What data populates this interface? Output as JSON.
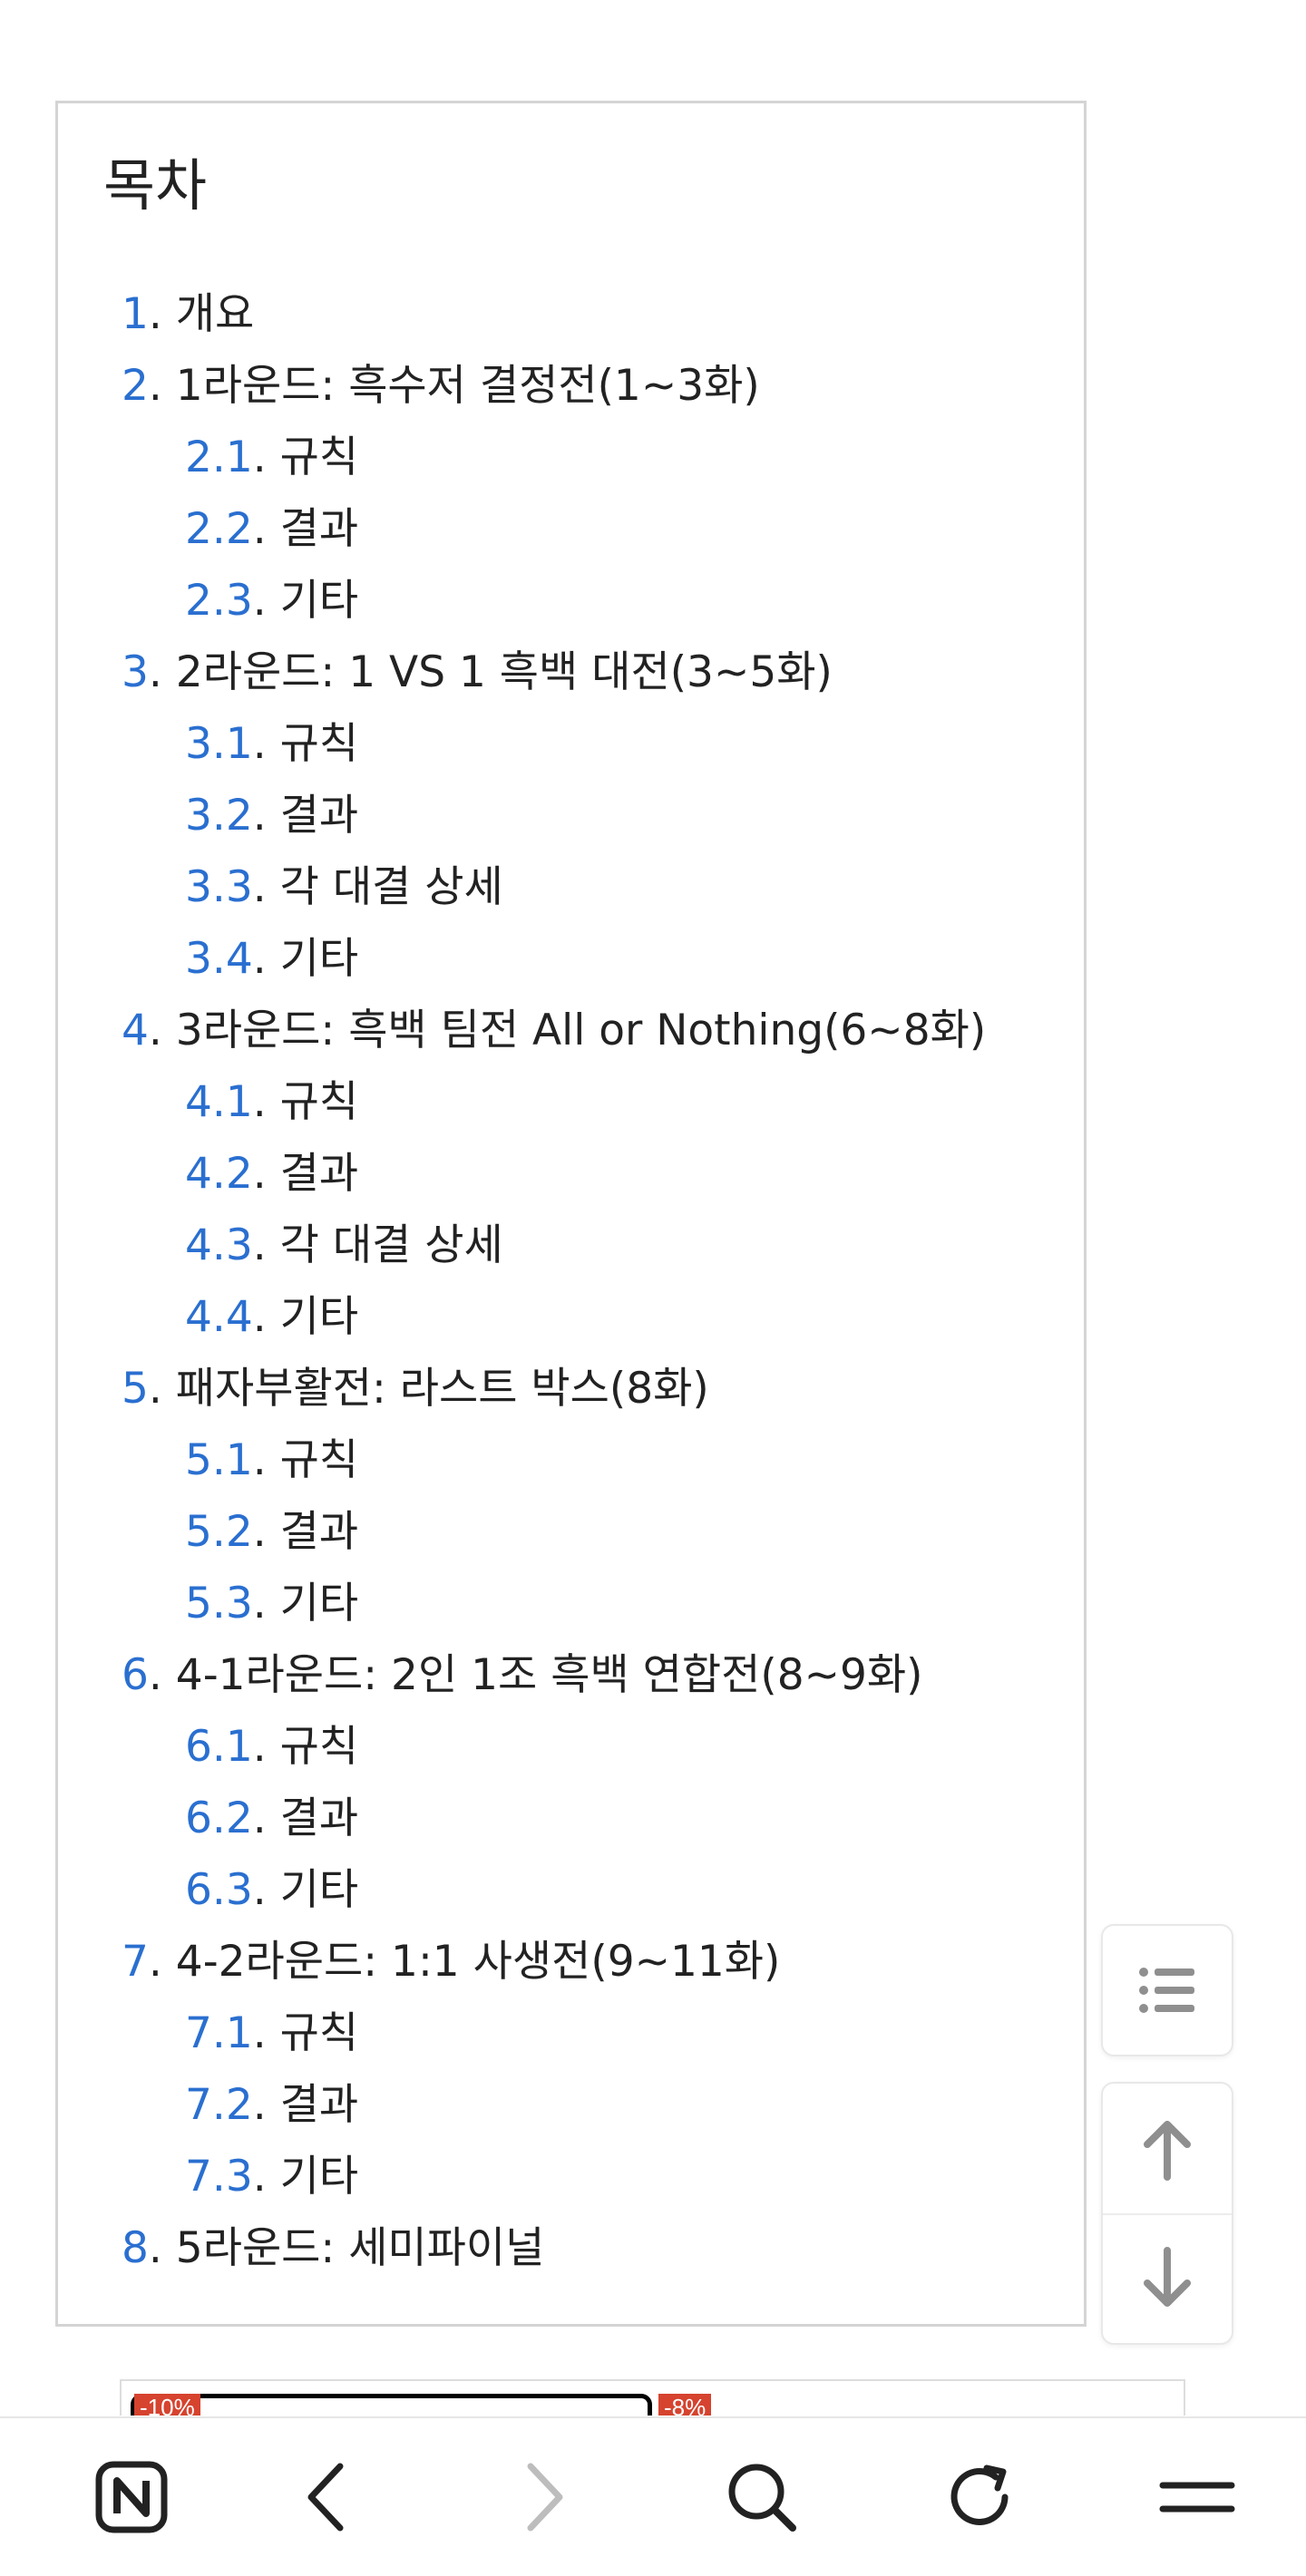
{
  "toc": {
    "title": "목차",
    "items": [
      {
        "num": "1",
        "text": "개요",
        "level": 1
      },
      {
        "num": "2",
        "text": "1라운드: 흑수저 결정전(1~3화)",
        "level": 1
      },
      {
        "num": "2.1",
        "text": "규칙",
        "level": 2
      },
      {
        "num": "2.2",
        "text": "결과",
        "level": 2
      },
      {
        "num": "2.3",
        "text": "기타",
        "level": 2
      },
      {
        "num": "3",
        "text": "2라운드: 1 VS 1 흑백 대전(3~5화)",
        "level": 1
      },
      {
        "num": "3.1",
        "text": "규칙",
        "level": 2
      },
      {
        "num": "3.2",
        "text": "결과",
        "level": 2
      },
      {
        "num": "3.3",
        "text": "각 대결 상세",
        "level": 2
      },
      {
        "num": "3.4",
        "text": "기타",
        "level": 2
      },
      {
        "num": "4",
        "text": "3라운드: 흑백 팀전 All or Nothing(6~8화)",
        "level": 1
      },
      {
        "num": "4.1",
        "text": "규칙",
        "level": 2
      },
      {
        "num": "4.2",
        "text": "결과",
        "level": 2
      },
      {
        "num": "4.3",
        "text": "각 대결 상세",
        "level": 2
      },
      {
        "num": "4.4",
        "text": "기타",
        "level": 2
      },
      {
        "num": "5",
        "text": "패자부활전: 라스트 박스(8화)",
        "level": 1
      },
      {
        "num": "5.1",
        "text": "규칙",
        "level": 2
      },
      {
        "num": "5.2",
        "text": "결과",
        "level": 2
      },
      {
        "num": "5.3",
        "text": "기타",
        "level": 2
      },
      {
        "num": "6",
        "text": "4-1라운드: 2인 1조 흑백 연합전(8~9화)",
        "level": 1
      },
      {
        "num": "6.1",
        "text": "규칙",
        "level": 2
      },
      {
        "num": "6.2",
        "text": "결과",
        "level": 2
      },
      {
        "num": "6.3",
        "text": "기타",
        "level": 2
      },
      {
        "num": "7",
        "text": "4-2라운드: 1:1 사생전(9~11화)",
        "level": 1
      },
      {
        "num": "7.1",
        "text": "규칙",
        "level": 2
      },
      {
        "num": "7.2",
        "text": "결과",
        "level": 2
      },
      {
        "num": "7.3",
        "text": "기타",
        "level": 2
      },
      {
        "num": "8",
        "text": "5라운드: 세미파이널",
        "level": 1
      }
    ]
  },
  "ad": {
    "badge_left": "-10%",
    "badge_right": "-8%"
  },
  "floating_buttons": {
    "toc_icon": "list-icon",
    "up_icon": "arrow-up-icon",
    "down_icon": "arrow-down-icon"
  },
  "bottom_nav": {
    "items": [
      {
        "icon": "namuwiki-home-icon"
      },
      {
        "icon": "back-chevron-icon"
      },
      {
        "icon": "forward-chevron-icon"
      },
      {
        "icon": "search-icon"
      },
      {
        "icon": "refresh-icon"
      },
      {
        "icon": "menu-icon"
      }
    ]
  },
  "colors": {
    "link": "#2a6fd0",
    "text": "#222222",
    "border": "#d4d4d4",
    "icon_gray": "#8f8f8f",
    "ad_badge": "#d6432f"
  }
}
